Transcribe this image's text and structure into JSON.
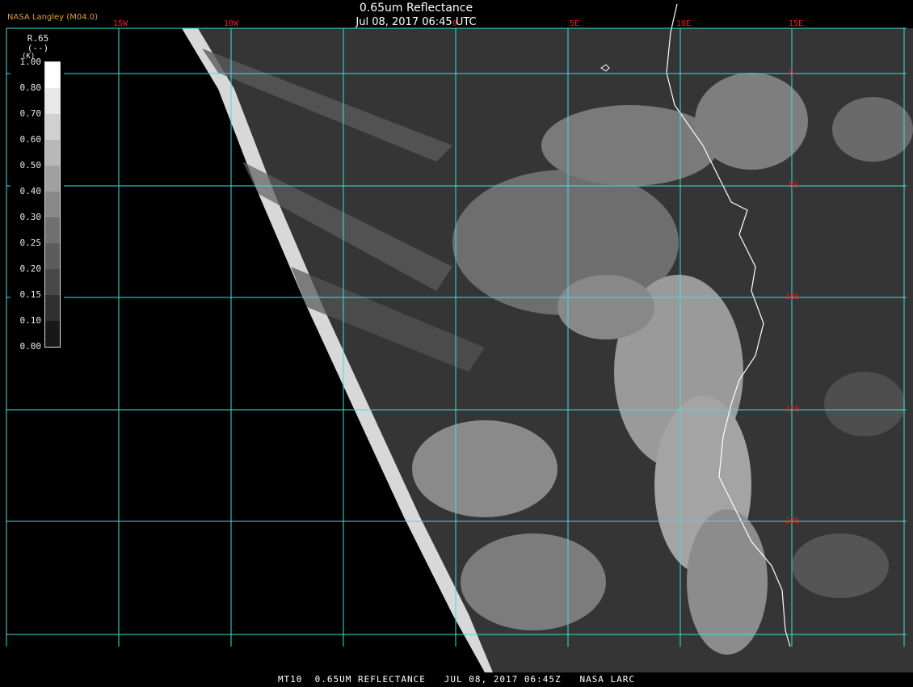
{
  "header": {
    "org": "NASA Langley (M04.0)",
    "title": "0.65um Reflectance",
    "datetime": "Jul 08, 2017 06:45 UTC"
  },
  "footer": {
    "text": "MT10  0.65UM REFLECTANCE   JUL 08, 2017 06:45Z   NASA LARC"
  },
  "legend": {
    "title_line1": "R.65",
    "title_line2": "(--)",
    "title_line3": "(K)",
    "ticks": [
      "1.00",
      "0.80",
      "0.70",
      "0.60",
      "0.50",
      "0.40",
      "0.30",
      "0.25",
      "0.20",
      "0.15",
      "0.10",
      "0.00"
    ]
  },
  "grid": {
    "lon_labels": [
      "15W",
      "10W",
      "0",
      "5E",
      "10E",
      "15E"
    ],
    "lat_labels": [
      "0",
      "5S",
      "10S",
      "15S",
      "20S"
    ],
    "grid_color": "#40e0e0",
    "label_color": "#e02020",
    "coast_color": "#ffffff"
  }
}
